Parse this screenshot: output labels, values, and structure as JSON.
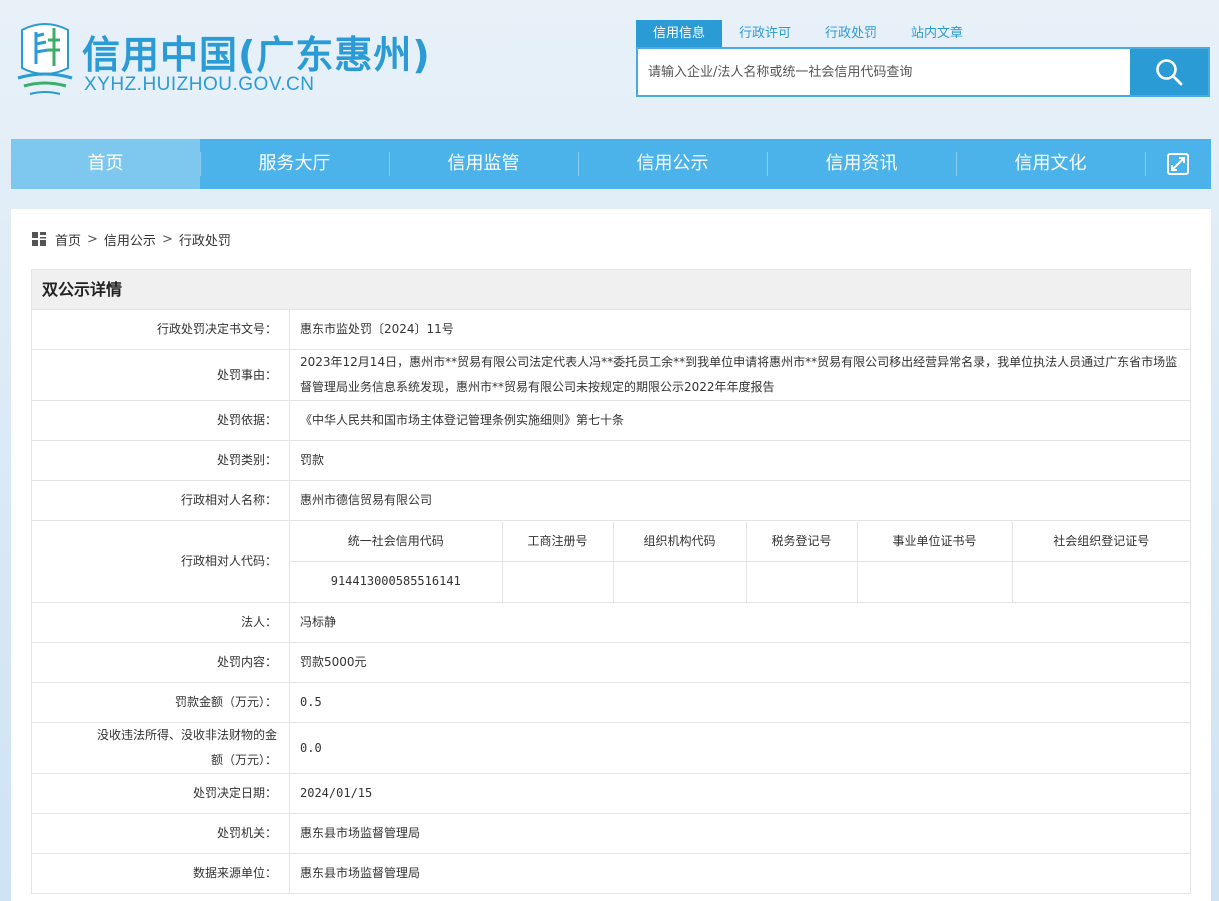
{
  "header": {
    "title": "信用中国(广东惠州)",
    "url": "XYHZ.HUIZHOU.GOV.CN"
  },
  "search": {
    "tabs": [
      "信用信息",
      "行政许可",
      "行政处罚",
      "站内文章"
    ],
    "active_tab": "信用信息",
    "placeholder": "请输入企业/法人名称或统一社会信用代码查询",
    "button_icon": "search-icon"
  },
  "nav": {
    "items": [
      "首页",
      "服务大厅",
      "信用监管",
      "信用公示",
      "信用资讯",
      "信用文化"
    ],
    "active": "首页",
    "expand_icon": "expand-icon"
  },
  "breadcrumb": {
    "items": [
      "首页",
      "信用公示",
      "行政处罚"
    ],
    "separator": ">"
  },
  "detail": {
    "title": "双公示详情",
    "rows": [
      {
        "label": "行政处罚决定书文号：",
        "value": "惠东市监处罚〔2024〕11号"
      },
      {
        "label": "处罚事由：",
        "value": "2023年12月14日，惠州市**贸易有限公司法定代表人冯**委托员工余**到我单位申请将惠州市**贸易有限公司移出经营异常名录，我单位执法人员通过广东省市场监督管理局业务信息系统发现，惠州市**贸易有限公司未按规定的期限公示2022年年度报告"
      },
      {
        "label": "处罚依据：",
        "value": "《中华人民共和国市场主体登记管理条例实施细则》第七十条"
      },
      {
        "label": "处罚类别：",
        "value": "罚款"
      },
      {
        "label": "行政相对人名称：",
        "value": "惠州市德信贸易有限公司"
      }
    ],
    "code_row": {
      "label": "行政相对人代码：",
      "headers": [
        "统一社会信用代码",
        "工商注册号",
        "组织机构代码",
        "税务登记号",
        "事业单位证书号",
        "社会组织登记证号"
      ],
      "values": [
        "914413000585516141",
        "",
        "",
        "",
        "",
        ""
      ]
    },
    "rows2": [
      {
        "label": "法人：",
        "value": "冯标静"
      },
      {
        "label": "处罚内容：",
        "value": "罚款5000元"
      },
      {
        "label": "罚款金额（万元）：",
        "value": "0.5"
      },
      {
        "label": "没收违法所得、没收非法财物的金额（万元）：",
        "value": "0.0"
      },
      {
        "label": "处罚决定日期：",
        "value": "2024/01/15"
      },
      {
        "label": "处罚机关：",
        "value": "惠东县市场监督管理局"
      },
      {
        "label": "数据来源单位：",
        "value": "惠东县市场监督管理局"
      }
    ]
  },
  "colors": {
    "brand": "#2b9bd6",
    "nav_bg": "#4bb3ea",
    "nav_active": "#7ec8f0"
  }
}
